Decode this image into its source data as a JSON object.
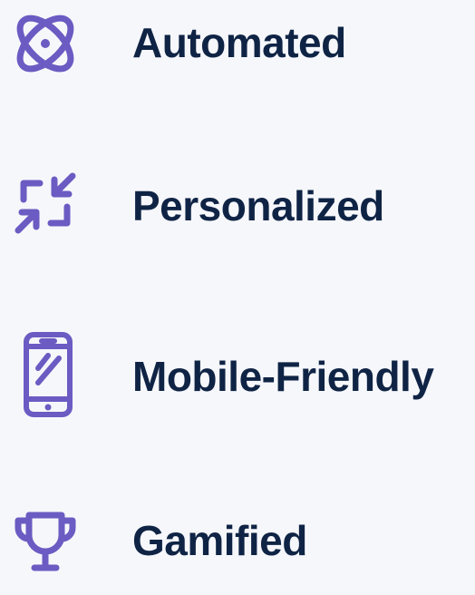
{
  "features": [
    {
      "label": "Automated",
      "icon": "atom-icon"
    },
    {
      "label": "Personalized",
      "icon": "arrows-in-icon"
    },
    {
      "label": "Mobile-Friendly",
      "icon": "smartphone-icon"
    },
    {
      "label": "Gamified",
      "icon": "trophy-icon"
    }
  ],
  "colors": {
    "icon": "#6b5bc2",
    "text": "#0f2445",
    "background": "#f6f7fb"
  }
}
